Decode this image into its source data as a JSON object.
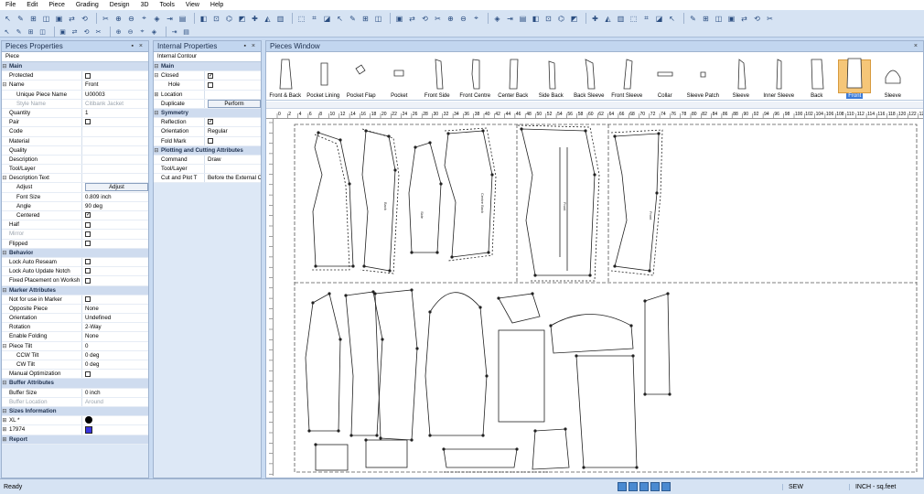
{
  "menu": [
    "File",
    "Edit",
    "Piece",
    "Grading",
    "Design",
    "3D",
    "Tools",
    "View",
    "Help"
  ],
  "pieces_properties": {
    "title": "Pieces Properties",
    "subtitle": "Piece",
    "rows": [
      {
        "type": "group",
        "label": "Main",
        "exp": "−"
      },
      {
        "label": "Protected",
        "check": false
      },
      {
        "label": "Name",
        "value": "Front",
        "exp": "−"
      },
      {
        "label": "Unique Piece Name",
        "value": "U00003",
        "indent": true
      },
      {
        "label": "Style Name",
        "value": "Citibank Jacket",
        "gray": true,
        "indent": true
      },
      {
        "label": "Quantity",
        "value": "1"
      },
      {
        "label": "Pair",
        "check": false
      },
      {
        "label": "Code",
        "value": ""
      },
      {
        "label": "Material",
        "value": ""
      },
      {
        "label": "Quality",
        "value": ""
      },
      {
        "label": "Description",
        "value": ""
      },
      {
        "label": "Tool/Layer",
        "value": ""
      },
      {
        "label": "Description Text",
        "value": "",
        "exp": "−"
      },
      {
        "label": "Adjust",
        "button": "Adjust",
        "indent": true
      },
      {
        "label": "Font Size",
        "value": "0.809 inch",
        "indent": true
      },
      {
        "label": "Angle",
        "value": "90 deg",
        "indent": true
      },
      {
        "label": "Centered",
        "check": true,
        "indent": true
      },
      {
        "label": "Half",
        "check": false
      },
      {
        "label": "Mirror",
        "check": false,
        "gray": true
      },
      {
        "label": "Flipped",
        "check": false
      },
      {
        "type": "group",
        "label": "Behavior",
        "exp": "−"
      },
      {
        "label": "Lock Auto Reseam",
        "check": false
      },
      {
        "label": "Lock Auto Update Notch",
        "check": false
      },
      {
        "label": "Fixed Placement on Worksh",
        "check": false
      },
      {
        "type": "group",
        "label": "Marker Attributes",
        "exp": "−"
      },
      {
        "label": "Not for use in Marker",
        "check": false
      },
      {
        "label": "Opposite Piece",
        "value": "None"
      },
      {
        "label": "Orientation",
        "value": "Undefined"
      },
      {
        "label": "Rotation",
        "value": "2-Way"
      },
      {
        "label": "Enable Folding",
        "value": "None"
      },
      {
        "label": "Piece Tilt",
        "value": "0",
        "exp": "−"
      },
      {
        "label": "CCW Tilt",
        "value": "0 deg",
        "indent": true
      },
      {
        "label": "CW Tilt",
        "value": "0 deg",
        "indent": true
      },
      {
        "label": "Manual Optimization",
        "check": false
      },
      {
        "type": "group",
        "label": "Buffer Attributes",
        "exp": "−"
      },
      {
        "label": "Buffer Size",
        "value": "0 inch"
      },
      {
        "label": "Buffer Location",
        "value": "Around",
        "gray": true
      },
      {
        "type": "group",
        "label": "Sizes Information",
        "exp": "−"
      },
      {
        "label": "XL *",
        "swatch": "dot",
        "exp": "+"
      },
      {
        "label": "17974",
        "swatch": "square",
        "exp": "+"
      },
      {
        "type": "group",
        "label": "Report",
        "exp": "+"
      }
    ]
  },
  "internal_properties": {
    "title": "Internal Properties",
    "subtitle": "Internal Contour",
    "rows": [
      {
        "type": "group",
        "label": "Main",
        "exp": "−"
      },
      {
        "label": "Closed",
        "check": true,
        "exp": "−"
      },
      {
        "label": "Hole",
        "check": false,
        "indent": true
      },
      {
        "label": "Location",
        "value": "",
        "exp": "+"
      },
      {
        "label": "Duplicate",
        "button": "Perform"
      },
      {
        "type": "group",
        "label": "Symmetry",
        "exp": "−"
      },
      {
        "label": "Reflection",
        "check": true
      },
      {
        "label": "Orientation",
        "value": "Regular"
      },
      {
        "label": "Fold Mark",
        "check": false
      },
      {
        "type": "group",
        "label": "Plotting and Cutting Attributes",
        "exp": "−"
      },
      {
        "label": "Command",
        "value": "Draw"
      },
      {
        "label": "Tool/Layer",
        "value": ""
      },
      {
        "label": "Cut and Plot T",
        "value": "Before the External Co"
      }
    ]
  },
  "pieces_window": {
    "title": "Pieces Window",
    "pieces": [
      "Front & Back",
      "Pocket Lining",
      "Pocket Flap",
      "Pocket",
      "Front Side",
      "Front Centre",
      "Center Back",
      "Side Back",
      "Back Sleeve",
      "Front Sleeve",
      "Collar",
      "Sleeve Patch",
      "Sleeve",
      "Inner Sleeve",
      "Back",
      "Front",
      "Sleeve"
    ],
    "selected_index": 15,
    "ruler_labels": [
      "0",
      "2",
      "4",
      "6",
      "8",
      "10",
      "12",
      "14",
      "16",
      "18",
      "20",
      "22",
      "24",
      "26",
      "28",
      "30",
      "32",
      "34",
      "36",
      "38",
      "40",
      "42",
      "44",
      "46",
      "48",
      "50",
      "52",
      "54",
      "56",
      "58",
      "60",
      "62",
      "64",
      "66",
      "68",
      "70",
      "72",
      "74",
      "76",
      "78",
      "80",
      "82",
      "84",
      "86",
      "88",
      "90",
      "92",
      "94",
      "96",
      "98",
      "100",
      "102",
      "104",
      "106",
      "108",
      "110",
      "112",
      "114",
      "116",
      "118",
      "120",
      "122",
      "124"
    ],
    "piece_labels": [
      "Front",
      "Back",
      "Centre Back",
      "Front",
      "Side"
    ]
  },
  "status": {
    "text": "Ready",
    "mode": "SEW",
    "units": "INCH - sq.feet"
  }
}
